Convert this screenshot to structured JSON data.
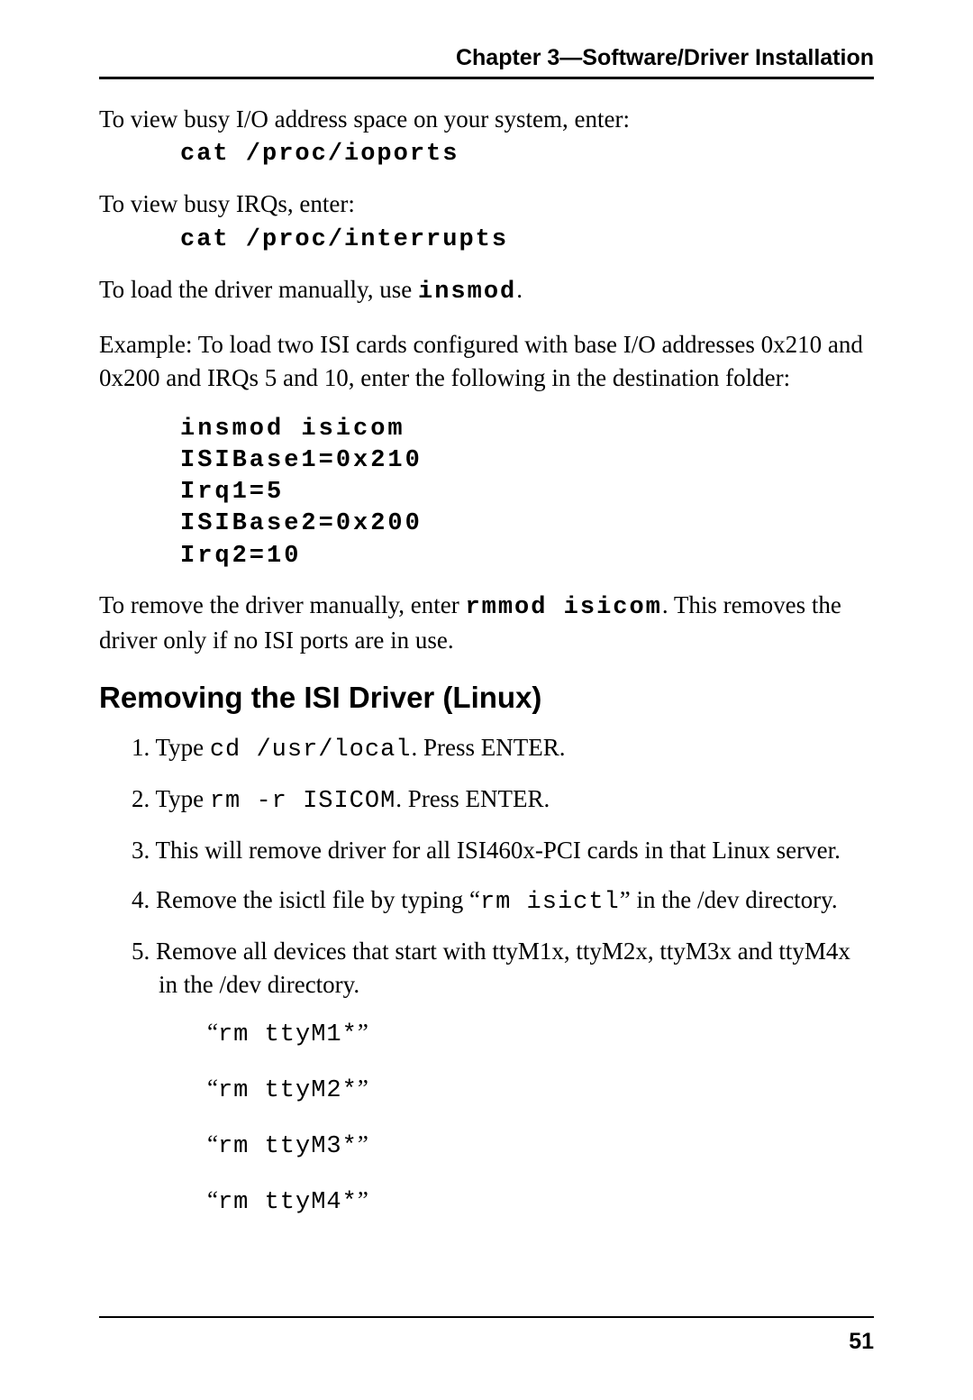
{
  "header": "Chapter 3—Software/Driver Installation",
  "p1_text": "To view busy I/O address space on your system, enter:",
  "p1_cmd": "cat /proc/ioports",
  "p2_text": "To view busy IRQs, enter:",
  "p2_cmd": "cat /proc/interrupts",
  "p3_a": "To load the driver manually, use ",
  "p3_cmd": "insmod",
  "p3_b": ".",
  "p4": "Example: To load two ISI cards configured with base I/O addresses 0x210 and 0x200 and IRQs 5 and 10, enter the following in the destination folder:",
  "code_block": {
    "l1": "insmod isicom",
    "l2": "ISIBase1=0x210",
    "l3": "Irq1=5",
    "l4": "ISIBase2=0x200",
    "l5": "Irq2=10"
  },
  "p5_a": "To remove the driver manually, enter ",
  "p5_cmd": "rmmod isicom",
  "p5_b": ".  This removes the driver only if no ISI ports are in use.",
  "heading": "Removing the ISI Driver (Linux)",
  "steps": {
    "s1_a": "1. Type ",
    "s1_cmd": "cd /usr/local",
    "s1_b": ". Press ENTER.",
    "s2_a": "2. Type ",
    "s2_cmd": "rm -r ISICOM",
    "s2_b": ". Press ENTER.",
    "s3": "3. This will remove driver for all ISI460x-PCI cards in that Linux server.",
    "s4_a": "4. Remove the isictl file by typing “",
    "s4_cmd": "rm isictl",
    "s4_b": "” in the /dev directory.",
    "s5": "5. Remove all devices that start with ttyM1x, ttyM2x, ttyM3x and ttyM4x in the /dev directory."
  },
  "quoted": {
    "q1_a": "“",
    "q1_cmd": "rm ttyM1*",
    "q1_b": "”",
    "q2_a": "“",
    "q2_cmd": "rm ttyM2*",
    "q2_b": "”",
    "q3_a": "“",
    "q3_cmd": "rm ttyM3*",
    "q3_b": "”",
    "q4_a": "“",
    "q4_cmd": "rm ttyM4*",
    "q4_b": "”"
  },
  "page_number": "51"
}
